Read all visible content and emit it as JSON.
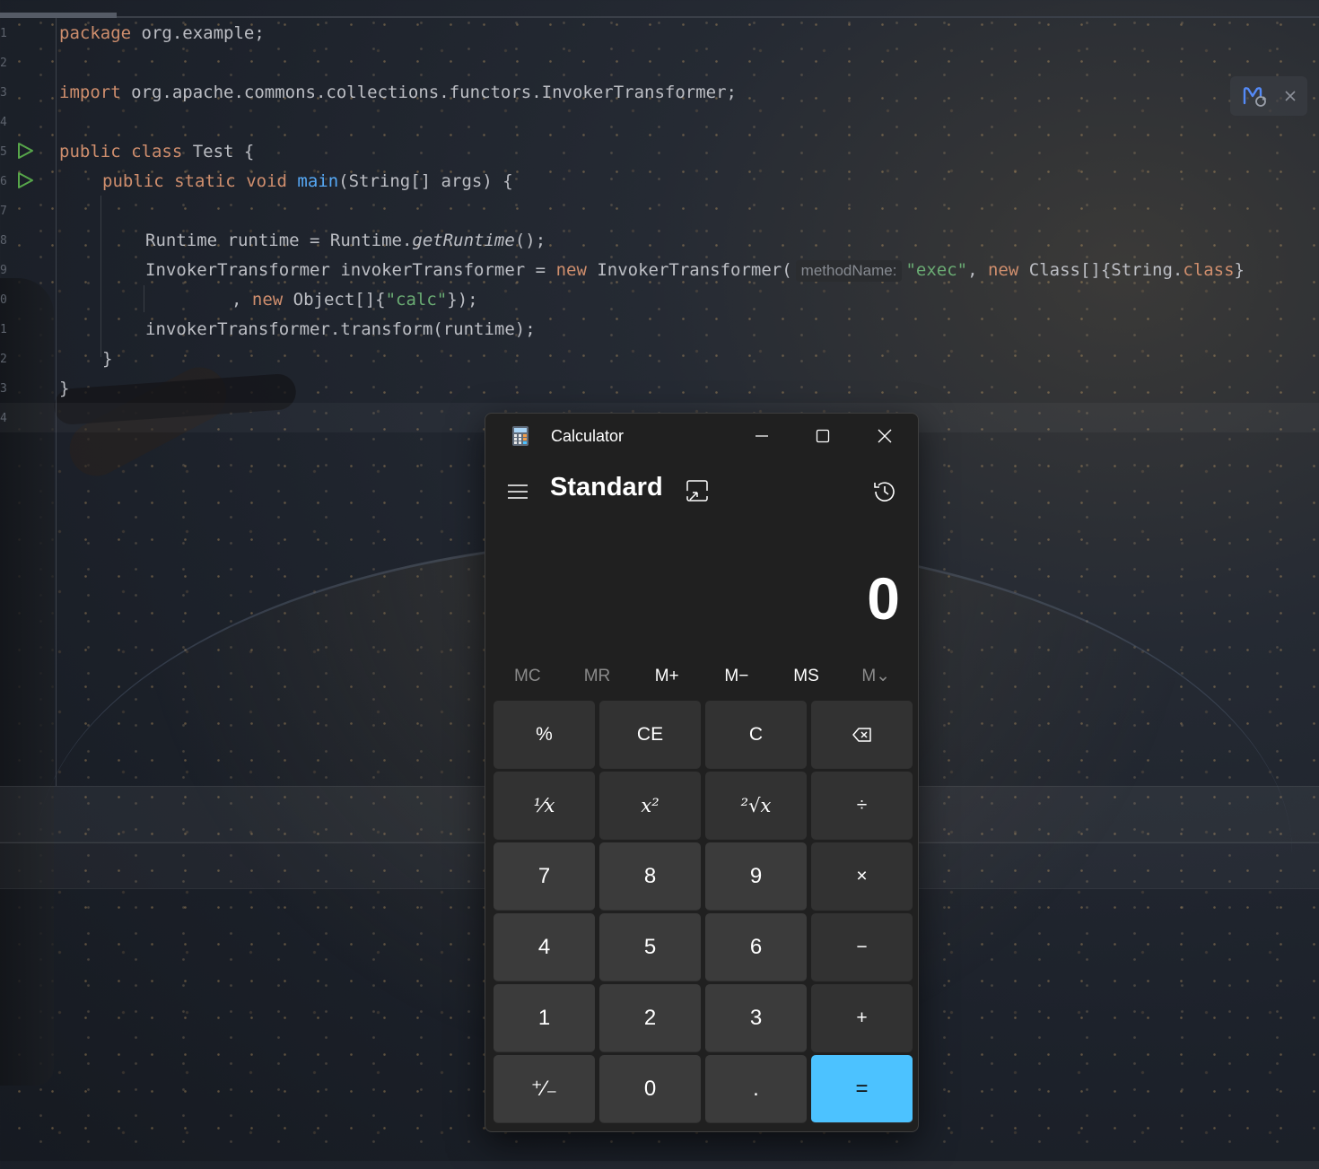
{
  "editor": {
    "line_numbers": [
      "1",
      "2",
      "3",
      "4",
      "5",
      "6",
      "7",
      "8",
      "9",
      "0",
      "1",
      "2",
      "3",
      "4"
    ],
    "code": {
      "l1_kw": "package",
      "l1_rest": " org.example;",
      "l3_kw": "import",
      "l3_rest": " org.apache.commons.collections.functors.InvokerTransformer;",
      "l5_kw1": "public",
      "l5_kw2": "class",
      "l5_rest": " Test {",
      "l6_kw1": "public",
      "l6_kw2": "static",
      "l6_kw3": "void",
      "l6_fn": "main",
      "l6_rest": "(String[] args) {",
      "l8_a": "Runtime runtime = Runtime.",
      "l8_it": "getRuntime",
      "l8_b": "();",
      "l9_a": "InvokerTransformer invokerTransformer = ",
      "l9_new": "new",
      "l9_b": " InvokerTransformer(",
      "l9_hint": "methodName:",
      "l9_str": "\"exec\"",
      "l9_c": ", ",
      "l9_new2": "new",
      "l9_d": " Class[]{String.",
      "l9_cls": "class",
      "l9_e": "}",
      "l10_a": ", ",
      "l10_new": "new",
      "l10_b": " Object[]{",
      "l10_str": "\"calc\"",
      "l10_c": "});",
      "l11": "invokerTransformer.transform(runtime);",
      "l12": "}",
      "l13": "}"
    }
  },
  "calculator": {
    "title": "Calculator",
    "mode": "Standard",
    "display": "0",
    "memory": [
      "MC",
      "MR",
      "M+",
      "M−",
      "MS",
      "M⌄"
    ],
    "keys": {
      "percent": "%",
      "ce": "CE",
      "c": "C",
      "backspace": "⌫",
      "reciprocal": "¹⁄x",
      "square": "x²",
      "sqrt": "²√x",
      "divide": "÷",
      "seven": "7",
      "eight": "8",
      "nine": "9",
      "multiply": "×",
      "four": "4",
      "five": "5",
      "six": "6",
      "minus": "−",
      "one": "1",
      "two": "2",
      "three": "3",
      "plus": "+",
      "negate": "⁺⁄₋",
      "zero": "0",
      "decimal": ".",
      "equals": "="
    },
    "accent_color": "#4cc2ff"
  }
}
